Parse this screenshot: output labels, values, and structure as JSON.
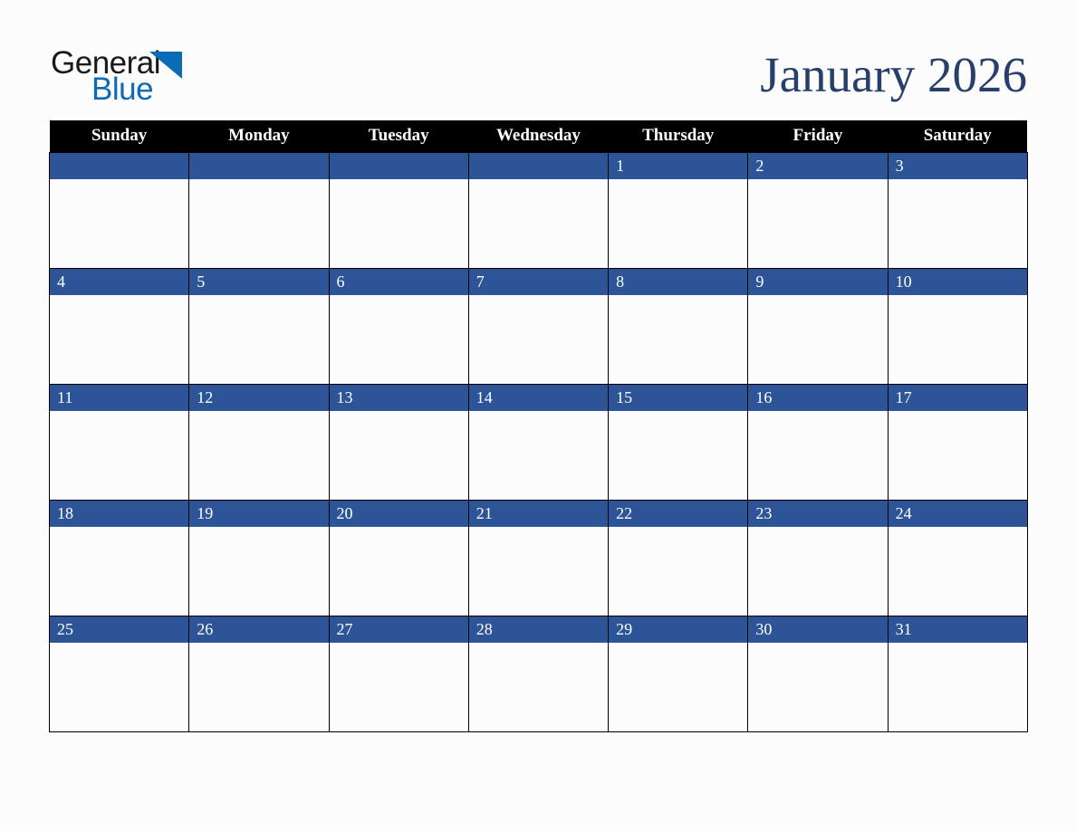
{
  "brand": {
    "name_part1": "General",
    "name_part2": "Blue",
    "triangle_icon": "triangle-right-icon",
    "color_dark": "#1a1a1a",
    "color_blue": "#0b6cb5"
  },
  "header": {
    "title": "January 2026",
    "title_color": "#27406b"
  },
  "calendar": {
    "month": "January",
    "year": "2026",
    "first_day_of_week": "Sunday",
    "days_in_month": 31,
    "colors": {
      "header_background": "#000000",
      "header_text": "#ffffff",
      "date_band_background": "#2d5496",
      "date_text": "#ffffff",
      "cell_background": "#fcfcfc",
      "grid_line": "#000000",
      "page_background": "#fcfcfc"
    },
    "day_headers": [
      "Sunday",
      "Monday",
      "Tuesday",
      "Wednesday",
      "Thursday",
      "Friday",
      "Saturday"
    ],
    "weeks": [
      {
        "index": 1,
        "days": [
          {
            "number": "",
            "events": ""
          },
          {
            "number": "",
            "events": ""
          },
          {
            "number": "",
            "events": ""
          },
          {
            "number": "",
            "events": ""
          },
          {
            "number": "1",
            "events": ""
          },
          {
            "number": "2",
            "events": ""
          },
          {
            "number": "3",
            "events": ""
          }
        ]
      },
      {
        "index": 2,
        "days": [
          {
            "number": "4",
            "events": ""
          },
          {
            "number": "5",
            "events": ""
          },
          {
            "number": "6",
            "events": ""
          },
          {
            "number": "7",
            "events": ""
          },
          {
            "number": "8",
            "events": ""
          },
          {
            "number": "9",
            "events": ""
          },
          {
            "number": "10",
            "events": ""
          }
        ]
      },
      {
        "index": 3,
        "days": [
          {
            "number": "11",
            "events": ""
          },
          {
            "number": "12",
            "events": ""
          },
          {
            "number": "13",
            "events": ""
          },
          {
            "number": "14",
            "events": ""
          },
          {
            "number": "15",
            "events": ""
          },
          {
            "number": "16",
            "events": ""
          },
          {
            "number": "17",
            "events": ""
          }
        ]
      },
      {
        "index": 4,
        "days": [
          {
            "number": "18",
            "events": ""
          },
          {
            "number": "19",
            "events": ""
          },
          {
            "number": "20",
            "events": ""
          },
          {
            "number": "21",
            "events": ""
          },
          {
            "number": "22",
            "events": ""
          },
          {
            "number": "23",
            "events": ""
          },
          {
            "number": "24",
            "events": ""
          }
        ]
      },
      {
        "index": 5,
        "days": [
          {
            "number": "25",
            "events": ""
          },
          {
            "number": "26",
            "events": ""
          },
          {
            "number": "27",
            "events": ""
          },
          {
            "number": "28",
            "events": ""
          },
          {
            "number": "29",
            "events": ""
          },
          {
            "number": "30",
            "events": ""
          },
          {
            "number": "31",
            "events": ""
          }
        ]
      }
    ]
  }
}
